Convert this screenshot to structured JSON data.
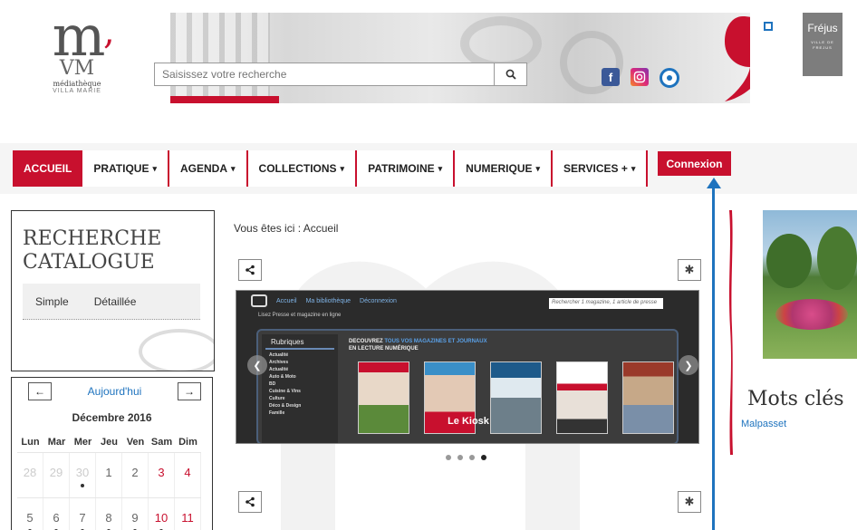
{
  "header": {
    "logo": {
      "mark": "m",
      "sub": "VM",
      "line1": "médiathèque",
      "line2": "VILLA MARIE"
    },
    "search": {
      "placeholder": "Saisissez votre recherche",
      "value": ""
    },
    "social": {
      "facebook": "f",
      "instagram": "",
      "eye": ""
    },
    "city_logo": {
      "name": "Fréjus",
      "tagline": "VILLE DE FREJUS"
    }
  },
  "nav": {
    "items": [
      {
        "label": "ACCUEIL",
        "active": true,
        "caret": ""
      },
      {
        "label": "PRATIQUE",
        "active": false,
        "caret": "▾"
      },
      {
        "label": "AGENDA",
        "active": false,
        "caret": "▾"
      },
      {
        "label": "COLLECTIONS",
        "active": false,
        "caret": "▾"
      },
      {
        "label": "PATRIMOINE",
        "active": false,
        "caret": "▾"
      },
      {
        "label": "NUMERIQUE",
        "active": false,
        "caret": "▾"
      },
      {
        "label": "SERVICES +",
        "active": false,
        "caret": "▾"
      }
    ],
    "connexion": "Connexion"
  },
  "catalog": {
    "title": "RECHERCHE CATALOGUE",
    "tab_simple": "Simple",
    "tab_detailed": "Détaillée"
  },
  "calendar": {
    "prev": "←",
    "today": "Aujourd'hui",
    "next": "→",
    "month": "Décembre 2016",
    "weekdays": [
      "Lun",
      "Mar",
      "Mer",
      "Jeu",
      "Ven",
      "Sam",
      "Dim"
    ],
    "rows": [
      [
        {
          "d": "28",
          "m": true,
          "dot": false,
          "w": false
        },
        {
          "d": "29",
          "m": true,
          "dot": false,
          "w": false
        },
        {
          "d": "30",
          "m": true,
          "dot": true,
          "w": false
        },
        {
          "d": "1",
          "m": false,
          "dot": false,
          "w": false
        },
        {
          "d": "2",
          "m": false,
          "dot": false,
          "w": false
        },
        {
          "d": "3",
          "m": false,
          "dot": false,
          "w": true
        },
        {
          "d": "4",
          "m": false,
          "dot": false,
          "w": true
        }
      ],
      [
        {
          "d": "5",
          "m": false,
          "dot": true,
          "w": false
        },
        {
          "d": "6",
          "m": false,
          "dot": true,
          "w": false
        },
        {
          "d": "7",
          "m": false,
          "dot": true,
          "w": false
        },
        {
          "d": "8",
          "m": false,
          "dot": true,
          "w": false
        },
        {
          "d": "9",
          "m": false,
          "dot": true,
          "w": false
        },
        {
          "d": "10",
          "m": false,
          "dot": true,
          "w": true
        },
        {
          "d": "11",
          "m": false,
          "dot": false,
          "w": true
        }
      ]
    ]
  },
  "main": {
    "breadcrumb": "Vous êtes ici : Accueil",
    "share_icon": "share-icon",
    "settings_icon": "gear-icon",
    "slides_total": 4,
    "slide_active": 4
  },
  "kiosk": {
    "nav_home": "Accueil",
    "nav_library": "Ma bibliothèque",
    "nav_logout": "Déconnexion",
    "search_placeholder": "Rechercher 1 magazine, 1 article de presse",
    "subtitle": "Lisez Presse et magazine en ligne",
    "rubriques_title": "Rubriques",
    "rubriques": [
      "Actualité",
      "Archives",
      "Actualité",
      "Auto & Moto",
      "BD",
      "Cuisine & Vins",
      "Culture",
      "Déco & Design",
      "Famille"
    ],
    "intro_line1_a": "DECOUVREZ ",
    "intro_line1_b": "TOUS VOS MAGAZINES ET JOURNAUX",
    "intro_line2": "EN LECTURE NUMÉRIQUE",
    "caption": "Le Kiosk"
  },
  "right": {
    "keywords_title": "Mots clés",
    "keyword_link": "Malpasset"
  },
  "colors": {
    "accent": "#c8102e",
    "link": "#1e73be",
    "kiosk_bg": "#2b2b2b"
  }
}
